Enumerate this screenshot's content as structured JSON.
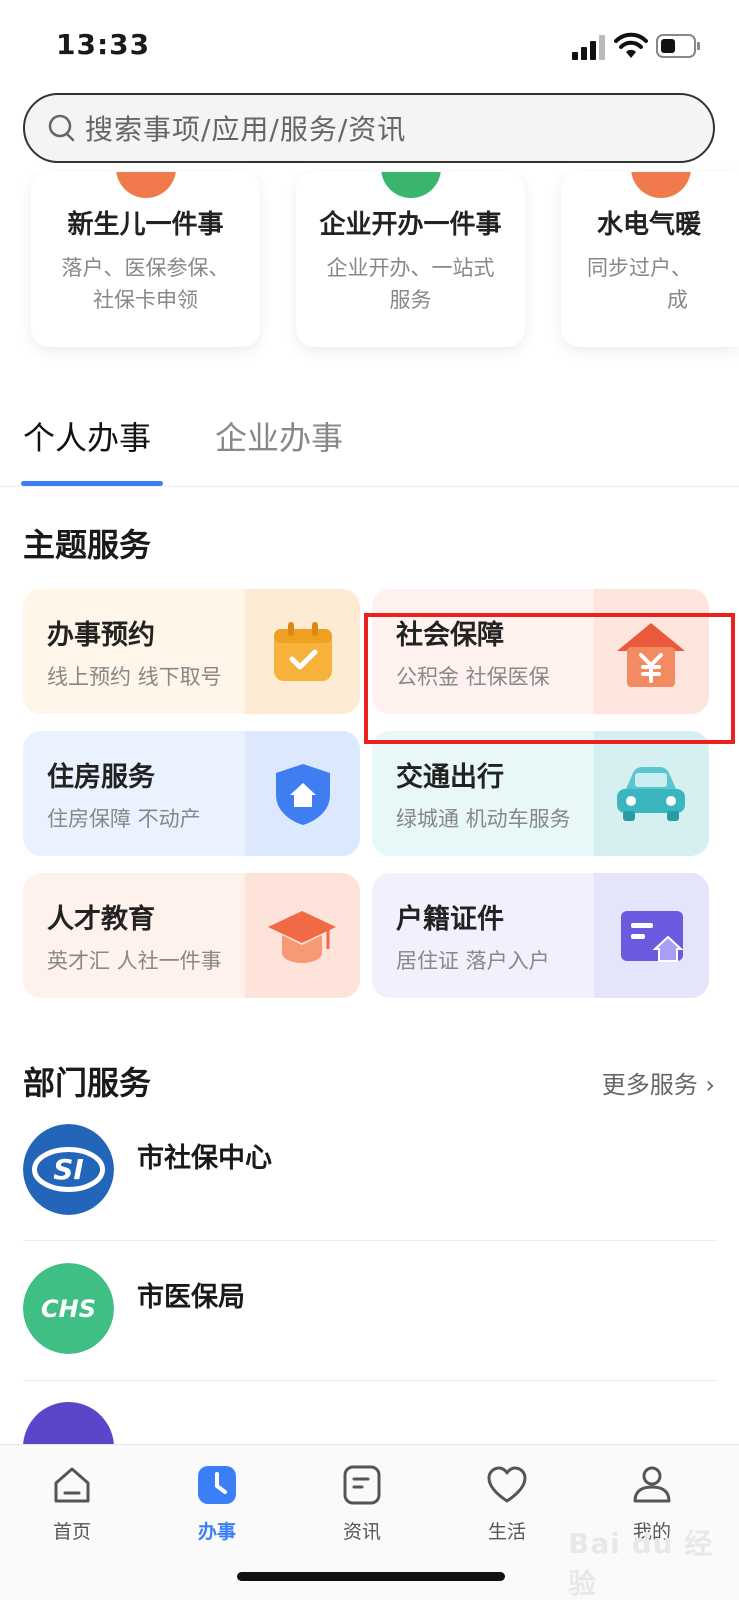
{
  "status_bar": {
    "time": "13:33"
  },
  "search": {
    "placeholder": "搜索事项/应用/服务/资讯"
  },
  "promos": [
    {
      "title": "新生儿一件事",
      "sub1": "落户、医保参保、",
      "sub2": "社保卡申领",
      "color": "#f07a4c"
    },
    {
      "title": "企业开办一件事",
      "sub1": "企业开办、一站式",
      "sub2": "服务",
      "color": "#3bb56e"
    },
    {
      "title": "水电气暖",
      "sub1": "同步过户、",
      "sub2": "成",
      "color": "#f07a4c"
    }
  ],
  "tabs": [
    {
      "label": "个人办事"
    },
    {
      "label": "企业办事"
    }
  ],
  "theme": {
    "title": "主题服务",
    "cards": [
      {
        "title": "办事预约",
        "sub": "线上预约 线下取号",
        "bg": "#fff5e8",
        "icon": "calendar-check-icon"
      },
      {
        "title": "社会保障",
        "sub": "公积金 社保医保",
        "bg": "#fff2ee",
        "icon": "house-yuan-icon"
      },
      {
        "title": "住房服务",
        "sub": "住房保障 不动产",
        "bg": "#eaf2ff",
        "icon": "shield-house-icon"
      },
      {
        "title": "交通出行",
        "sub": "绿城通 机动车服务",
        "bg": "#e8f7f8",
        "icon": "car-icon"
      },
      {
        "title": "人才教育",
        "sub": "英才汇 人社一件事",
        "bg": "#fff1ec",
        "icon": "graduation-cap-icon"
      },
      {
        "title": "户籍证件",
        "sub": "居住证 落户入户",
        "bg": "#f1f1fd",
        "icon": "id-card-icon"
      }
    ]
  },
  "dept": {
    "title": "部门服务",
    "more": "更多服务",
    "items": [
      {
        "name": "市社保中心",
        "logo_text": "SI",
        "logo_color": "#2365b8"
      },
      {
        "name": "市医保局",
        "logo_text": "CHS",
        "logo_color": "#3fbf83"
      }
    ]
  },
  "bottom_nav": [
    {
      "label": "首页",
      "icon": "home-icon"
    },
    {
      "label": "办事",
      "icon": "clock-icon"
    },
    {
      "label": "资讯",
      "icon": "document-icon"
    },
    {
      "label": "生活",
      "icon": "heart-icon"
    },
    {
      "label": "我的",
      "icon": "user-icon"
    }
  ],
  "watermark": "Bai du 经验"
}
